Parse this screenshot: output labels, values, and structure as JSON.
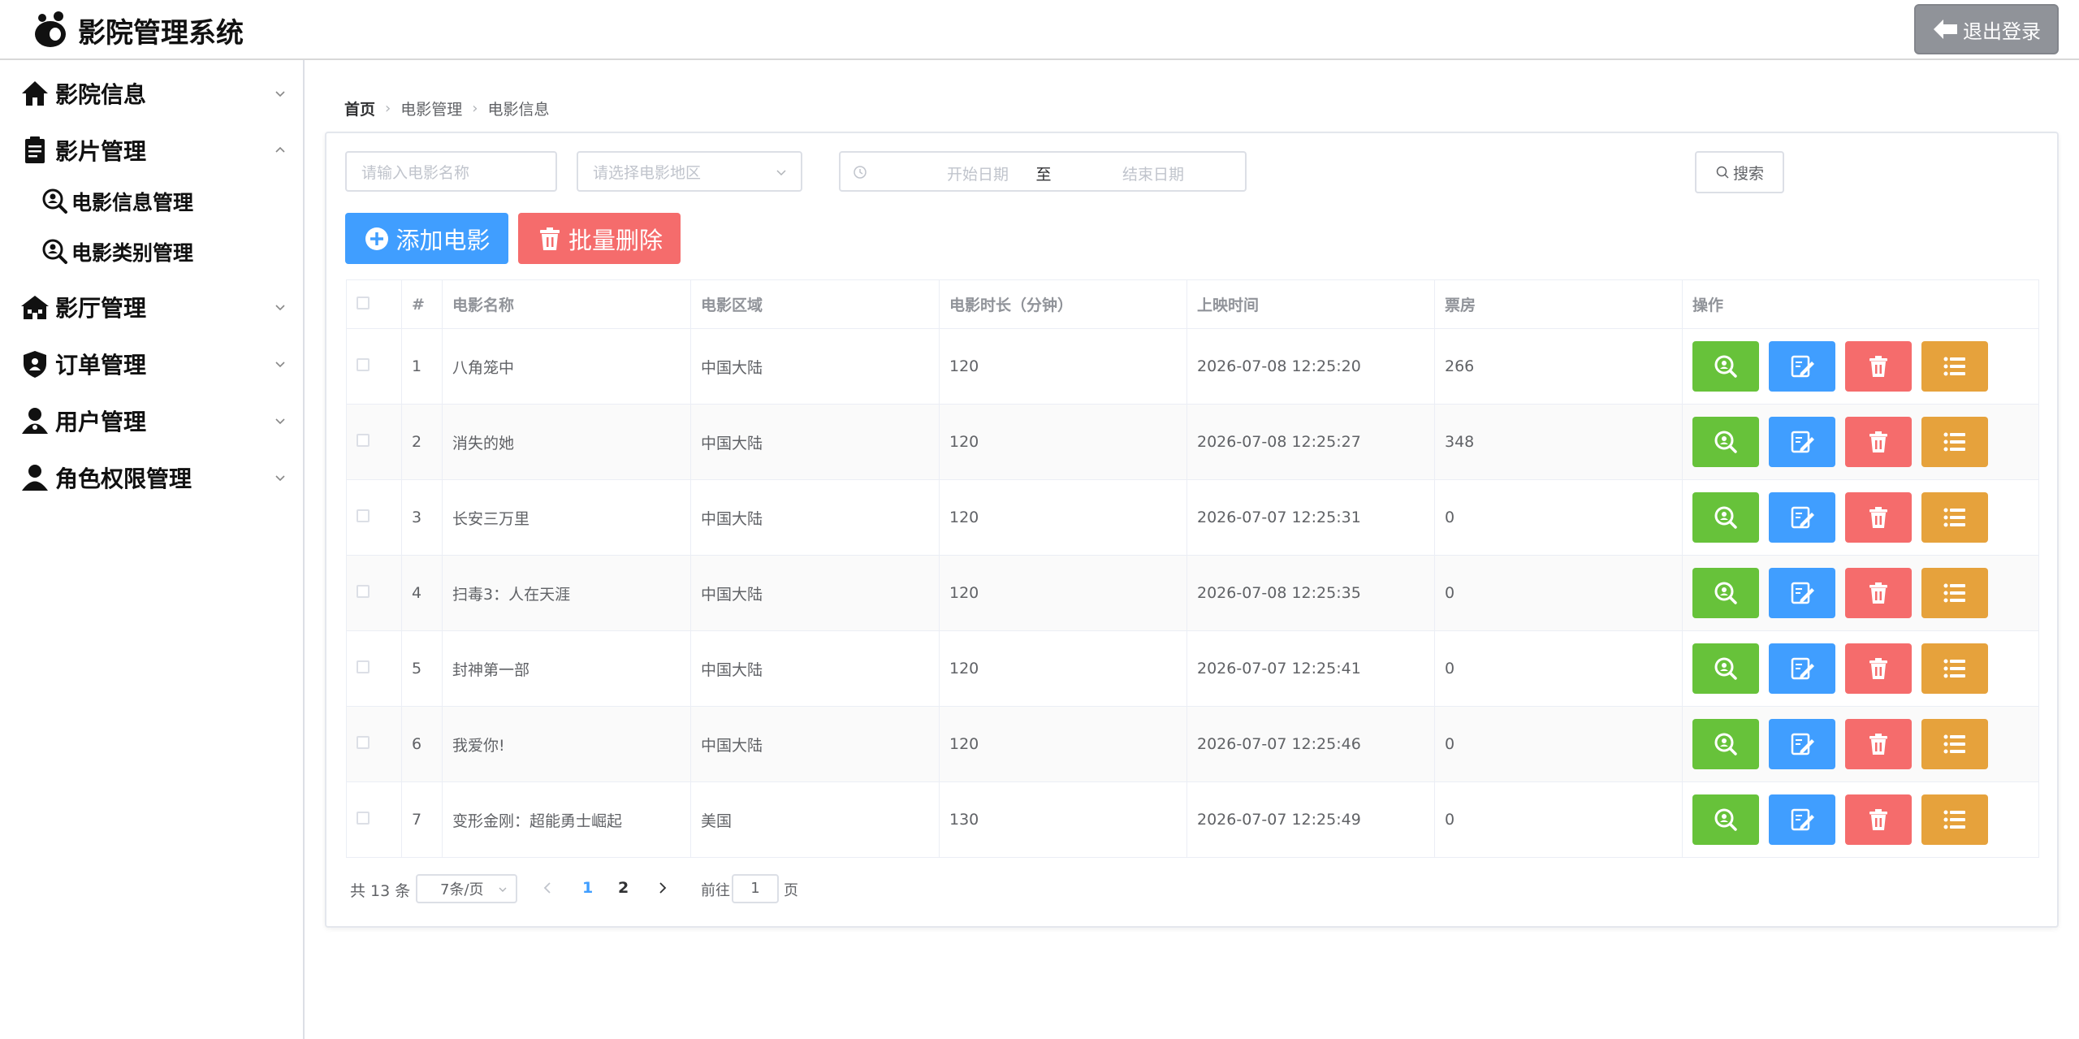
{
  "header": {
    "title": "影院管理系统",
    "logout_label": "退出登录"
  },
  "sidebar": {
    "items": [
      {
        "label": "影院信息"
      },
      {
        "label": "影片管理"
      },
      {
        "label": "影厅管理"
      },
      {
        "label": "订单管理"
      },
      {
        "label": "用户管理"
      },
      {
        "label": "角色权限管理"
      }
    ],
    "sub_items": [
      {
        "label": "电影信息管理"
      },
      {
        "label": "电影类别管理"
      }
    ]
  },
  "breadcrumb": [
    "首页",
    "电影管理",
    "电影信息"
  ],
  "filters": {
    "name_placeholder": "请输入电影名称",
    "region_placeholder": "请选择电影地区",
    "start_placeholder": "开始日期",
    "range_separator": "至",
    "end_placeholder": "结束日期",
    "search_label": "搜索"
  },
  "toolbar": {
    "add_label": "添加电影",
    "batch_delete_label": "批量删除"
  },
  "table": {
    "columns": [
      "#",
      "电影名称",
      "电影区域",
      "电影时长（分钟）",
      "上映时间",
      "票房",
      "操作"
    ],
    "rows": [
      {
        "idx": "1",
        "name": "八角笼中",
        "region": "中国大陆",
        "duration": "120",
        "release": "2026-07-08 12:25:20",
        "box": "266"
      },
      {
        "idx": "2",
        "name": "消失的她",
        "region": "中国大陆",
        "duration": "120",
        "release": "2026-07-08 12:25:27",
        "box": "348"
      },
      {
        "idx": "3",
        "name": "长安三万里",
        "region": "中国大陆",
        "duration": "120",
        "release": "2026-07-07 12:25:31",
        "box": "0"
      },
      {
        "idx": "4",
        "name": "扫毒3：人在天涯",
        "region": "中国大陆",
        "duration": "120",
        "release": "2026-07-08 12:25:35",
        "box": "0"
      },
      {
        "idx": "5",
        "name": "封神第一部",
        "region": "中国大陆",
        "duration": "120",
        "release": "2026-07-07 12:25:41",
        "box": "0"
      },
      {
        "idx": "6",
        "name": "我爱你!",
        "region": "中国大陆",
        "duration": "120",
        "release": "2026-07-07 12:25:46",
        "box": "0"
      },
      {
        "idx": "7",
        "name": "变形金刚：超能勇士崛起",
        "region": "美国",
        "duration": "130",
        "release": "2026-07-07 12:25:49",
        "box": "0"
      }
    ]
  },
  "pagination": {
    "total_text": "共 13 条",
    "page_size": "7条/页",
    "pages": [
      "1",
      "2"
    ],
    "goto_prefix": "前往",
    "goto_value": "1",
    "goto_suffix": "页"
  },
  "colors": {
    "primary": "#409eff",
    "success": "#67c23a",
    "danger": "#f56c6c",
    "warning": "#e6a23c",
    "info": "#909399"
  },
  "icons": [
    "logo-icon",
    "logout-arrow-icon",
    "home-icon",
    "clipboard-icon",
    "magnifier-person-icon",
    "building-icon",
    "shield-user-icon",
    "user-icon",
    "user-role-icon",
    "chevron-down-icon",
    "chevron-up-icon",
    "clock-icon",
    "search-icon",
    "add-circle-icon",
    "trash-icon",
    "edit-icon",
    "list-icon"
  ]
}
